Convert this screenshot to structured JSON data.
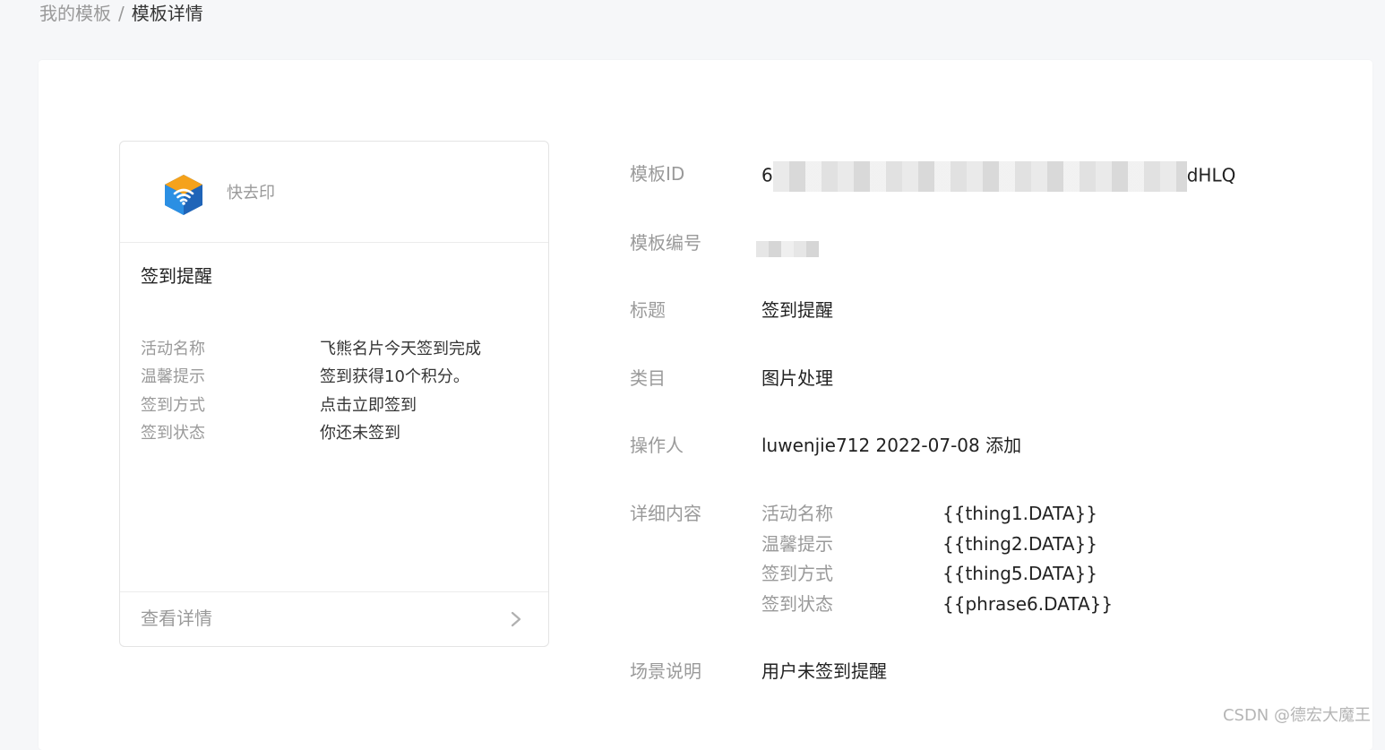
{
  "breadcrumb": {
    "parent": "我的模板",
    "separator": "/",
    "current": "模板详情"
  },
  "preview_card": {
    "app_name": "快去印",
    "title": "签到提醒",
    "fields": [
      {
        "label": "活动名称",
        "value": "飞熊名片今天签到完成"
      },
      {
        "label": "温馨提示",
        "value": "签到获得10个积分。"
      },
      {
        "label": "签到方式",
        "value": "点击立即签到"
      },
      {
        "label": "签到状态",
        "value": "你还未签到"
      }
    ],
    "footer_label": "查看详情"
  },
  "details": {
    "template_id": {
      "label": "模板ID",
      "prefix": "6",
      "suffix": "dHLQ"
    },
    "template_no": {
      "label": "模板编号"
    },
    "title": {
      "label": "标题",
      "value": "签到提醒"
    },
    "category": {
      "label": "类目",
      "value": "图片处理"
    },
    "operator": {
      "label": "操作人",
      "value": "luwenjie712 2022-07-08 添加"
    },
    "content": {
      "label": "详细内容",
      "rows": [
        {
          "key": "活动名称",
          "value": "{{thing1.DATA}}"
        },
        {
          "key": "温馨提示",
          "value": "{{thing2.DATA}}"
        },
        {
          "key": "签到方式",
          "value": "{{thing5.DATA}}"
        },
        {
          "key": "签到状态",
          "value": "{{phrase6.DATA}}"
        }
      ]
    },
    "scene": {
      "label": "场景说明",
      "value": "用户未签到提醒"
    }
  },
  "watermark": "CSDN @德宏大魔王",
  "icons": {
    "app_logo": "app-logo-icon",
    "chevron": "chevron-right-icon"
  }
}
